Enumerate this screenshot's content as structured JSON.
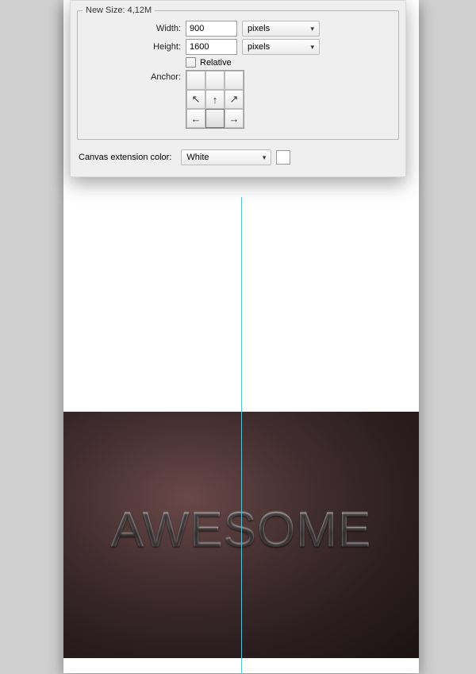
{
  "newSize": {
    "legend": "New Size: 4,12M",
    "widthLabel": "Width:",
    "widthValue": "900",
    "widthUnit": "pixels",
    "heightLabel": "Height:",
    "heightValue": "1600",
    "heightUnit": "pixels",
    "relativeLabel": "Relative",
    "anchorLabel": "Anchor:"
  },
  "extension": {
    "label": "Canvas extension color:",
    "value": "White"
  },
  "artwork": {
    "text": "AWESOME"
  }
}
